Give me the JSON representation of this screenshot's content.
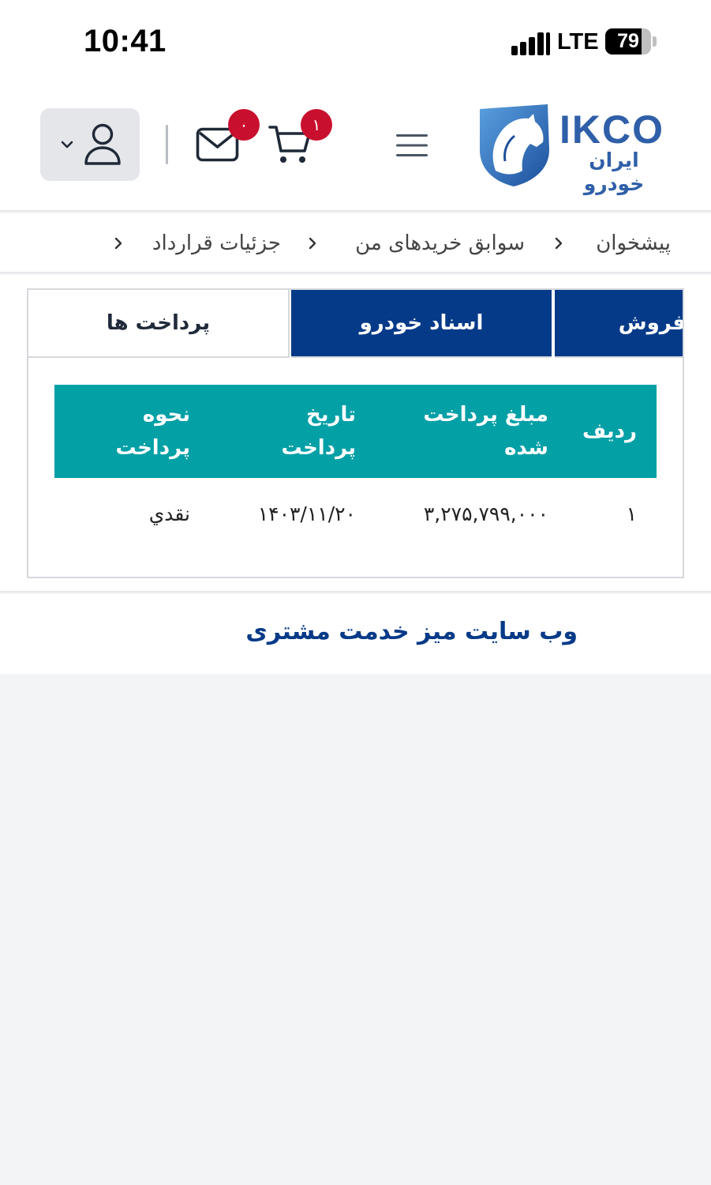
{
  "status_bar": {
    "time": "10:41",
    "network": "LTE",
    "battery": "79",
    "battery_level_percent": 79
  },
  "header": {
    "logo_text": "IKCO",
    "logo_text_fa": "ایران خودرو",
    "cart_count": "۱",
    "messages_count": "۰",
    "icons": [
      "user-icon",
      "chevron-down-icon",
      "mail-icon",
      "cart-icon",
      "menu-icon",
      "ikco-horse-logo"
    ]
  },
  "breadcrumb": {
    "items": [
      "پیشخوان",
      "سوابق خریدهای من",
      "جزئیات قرارداد"
    ]
  },
  "tabs": {
    "payments": "پرداخت ها",
    "vehicle_docs": "اسناد خودرو",
    "sales": "فروش"
  },
  "payments_table": {
    "headers": {
      "row": "ردیف",
      "amount_line1": "مبلغ پرداخت",
      "amount_line2": "شده",
      "date_line1": "تاریخ",
      "date_line2": "پرداخت",
      "method_line1": "نحوه",
      "method_line2": "پرداخت"
    },
    "rows": [
      {
        "row": "۱",
        "amount": "۳,۲۷۵,۷۹۹,۰۰۰",
        "date": "۱۴۰۳/۱۱/۲۰",
        "method": "نقدي"
      }
    ]
  },
  "footer": {
    "link": "وب سایت میز خدمت مشتری"
  },
  "colors": {
    "primary_navy": "#053a88",
    "table_header_teal": "#03a0a6",
    "badge_red": "#c8102e",
    "logo_blue": "#2f5fa8"
  }
}
